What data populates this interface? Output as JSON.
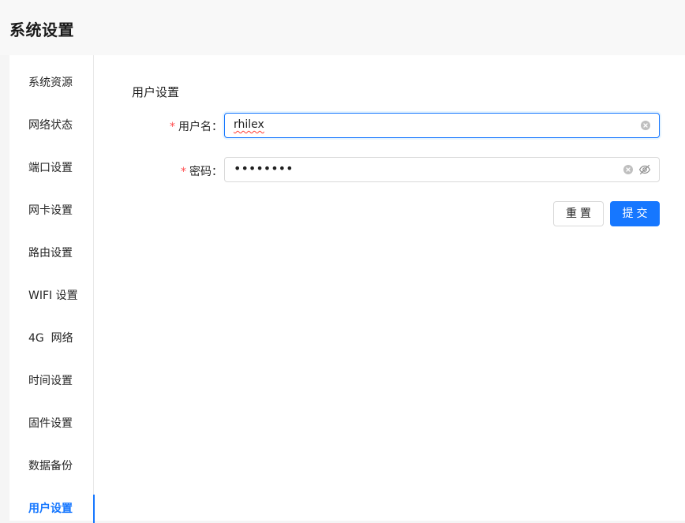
{
  "page": {
    "title": "系统设置"
  },
  "sidebar": {
    "items": [
      {
        "label": "系统资源"
      },
      {
        "label": "网络状态"
      },
      {
        "label": "端口设置"
      },
      {
        "label": "网卡设置"
      },
      {
        "label": "路由设置"
      },
      {
        "label": "WIFI 设置"
      },
      {
        "label": "4G  网络"
      },
      {
        "label": "时间设置"
      },
      {
        "label": "固件设置"
      },
      {
        "label": "数据备份"
      },
      {
        "label": "用户设置"
      }
    ],
    "active_label": "用户设置"
  },
  "form": {
    "section_title": "用户设置",
    "username_label": "用户名",
    "username_value": "rhilex",
    "password_label": "密码",
    "password_value": "••••••••",
    "required_mark": "*",
    "label_suffix": "："
  },
  "buttons": {
    "reset_label": "重置",
    "submit_label": "提交"
  },
  "colors": {
    "primary": "#1677ff",
    "required": "#ff4d4f",
    "border": "#d9d9d9"
  },
  "icons": {
    "clear": "close-circle-icon",
    "password_toggle": "eye-invisible-icon"
  }
}
